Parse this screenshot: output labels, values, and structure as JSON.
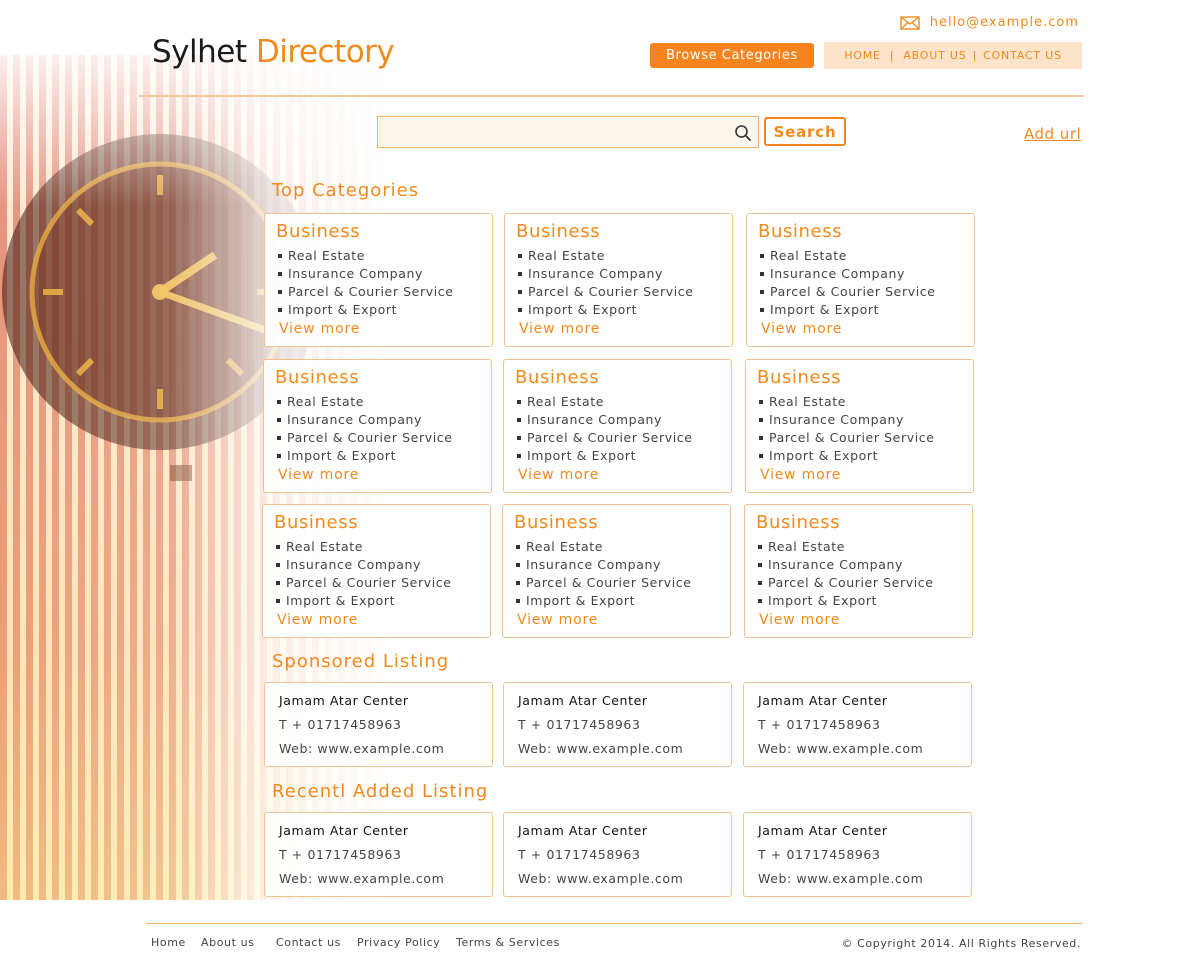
{
  "logo": {
    "part1": "Sylhet",
    "part2": "Directory"
  },
  "header": {
    "email": "hello@example.com",
    "browse_label": "Browse Categories",
    "nav": [
      "HOME",
      "ABOUT US",
      "CONTACT US"
    ],
    "nav_separator": "|"
  },
  "search": {
    "placeholder": "",
    "button_label": "Search",
    "add_url_label": "Add url"
  },
  "sections": {
    "top_categories": "Top Categories",
    "sponsored": "Sponsored Listing",
    "recent": "Recentl Added Listing"
  },
  "categories": [
    {
      "title": "Business",
      "items": [
        "Real Estate",
        "Insurance Company",
        "Parcel & Courier Service",
        "Import & Export"
      ],
      "more": "View more"
    },
    {
      "title": "Business",
      "items": [
        "Real Estate",
        "Insurance Company",
        "Parcel & Courier Service",
        "Import & Export"
      ],
      "more": "View more"
    },
    {
      "title": "Business",
      "items": [
        "Real Estate",
        "Insurance Company",
        "Parcel & Courier Service",
        "Import & Export"
      ],
      "more": "View more"
    },
    {
      "title": "Business",
      "items": [
        "Real Estate",
        "Insurance Company",
        "Parcel & Courier Service",
        "Import & Export"
      ],
      "more": "View more"
    },
    {
      "title": "Business",
      "items": [
        "Real Estate",
        "Insurance Company",
        "Parcel & Courier Service",
        "Import & Export"
      ],
      "more": "View more"
    },
    {
      "title": "Business",
      "items": [
        "Real Estate",
        "Insurance Company",
        "Parcel & Courier Service",
        "Import & Export"
      ],
      "more": "View more"
    },
    {
      "title": "Business",
      "items": [
        "Real Estate",
        "Insurance Company",
        "Parcel & Courier Service",
        "Import & Export"
      ],
      "more": "View more"
    },
    {
      "title": "Business",
      "items": [
        "Real Estate",
        "Insurance Company",
        "Parcel & Courier Service",
        "Import & Export"
      ],
      "more": "View more"
    },
    {
      "title": "Business",
      "items": [
        "Real Estate",
        "Insurance Company",
        "Parcel & Courier Service",
        "Import & Export"
      ],
      "more": "View more"
    }
  ],
  "sponsored": [
    {
      "name": "Jamam Atar Center",
      "phone": "T + 01717458963",
      "web": "Web: www.example.com"
    },
    {
      "name": "Jamam Atar Center",
      "phone": "T + 01717458963",
      "web": "Web: www.example.com"
    },
    {
      "name": "Jamam Atar Center",
      "phone": "T + 01717458963",
      "web": "Web: www.example.com"
    }
  ],
  "recent": [
    {
      "name": "Jamam Atar Center",
      "phone": "T + 01717458963",
      "web": "Web: www.example.com"
    },
    {
      "name": "Jamam Atar Center",
      "phone": "T + 01717458963",
      "web": "Web: www.example.com"
    },
    {
      "name": "Jamam Atar Center",
      "phone": "T + 01717458963",
      "web": "Web: www.example.com"
    }
  ],
  "footer": {
    "links": [
      "Home",
      "About us",
      "Contact us",
      "Privacy Policy",
      "Terms & Services"
    ],
    "copyright": "© Copyright 2014. All Rights Reserved."
  },
  "colors": {
    "accent": "#f08a1c",
    "accent_button": "#f5841f",
    "nav_bg": "#fde3c9",
    "border": "#f3c18f"
  },
  "icons": {
    "email": "envelope-icon",
    "search": "magnifier-icon",
    "background": "clock-tower-image"
  }
}
